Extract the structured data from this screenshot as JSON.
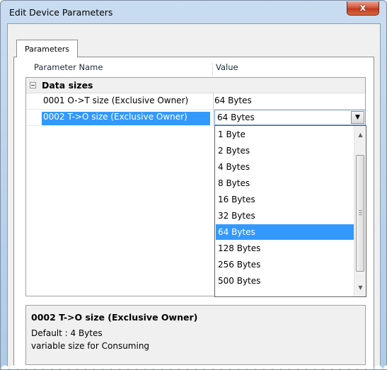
{
  "window": {
    "title": "Edit Device Parameters",
    "close_label": "x"
  },
  "tabs": [
    {
      "label": "Parameters"
    }
  ],
  "grid": {
    "headers": {
      "name": "Parameter Name",
      "value": "Value"
    },
    "category": {
      "label": "Data sizes",
      "expander": "⊟"
    },
    "rows": [
      {
        "name": "0001 O->T size (Exclusive Owner)",
        "value": "64 Bytes"
      },
      {
        "name": "0002 T->O size (Exclusive Owner)",
        "value": "64 Bytes"
      }
    ],
    "dropdown": {
      "selected": "64 Bytes",
      "options": [
        "1 Byte",
        "2 Bytes",
        "4 Bytes",
        "8 Bytes",
        "16 Bytes",
        "32 Bytes",
        "64 Bytes",
        "128 Bytes",
        "256 Bytes",
        "500 Bytes"
      ]
    }
  },
  "description": {
    "title": "0002 T->O size (Exclusive Owner)",
    "line1": "Default : 4 Bytes",
    "line2": "variable size for Consuming"
  },
  "colors": {
    "selection": "#3399ff",
    "title_gradient": "#b9d1ea",
    "close_button": "#c23a1f"
  }
}
